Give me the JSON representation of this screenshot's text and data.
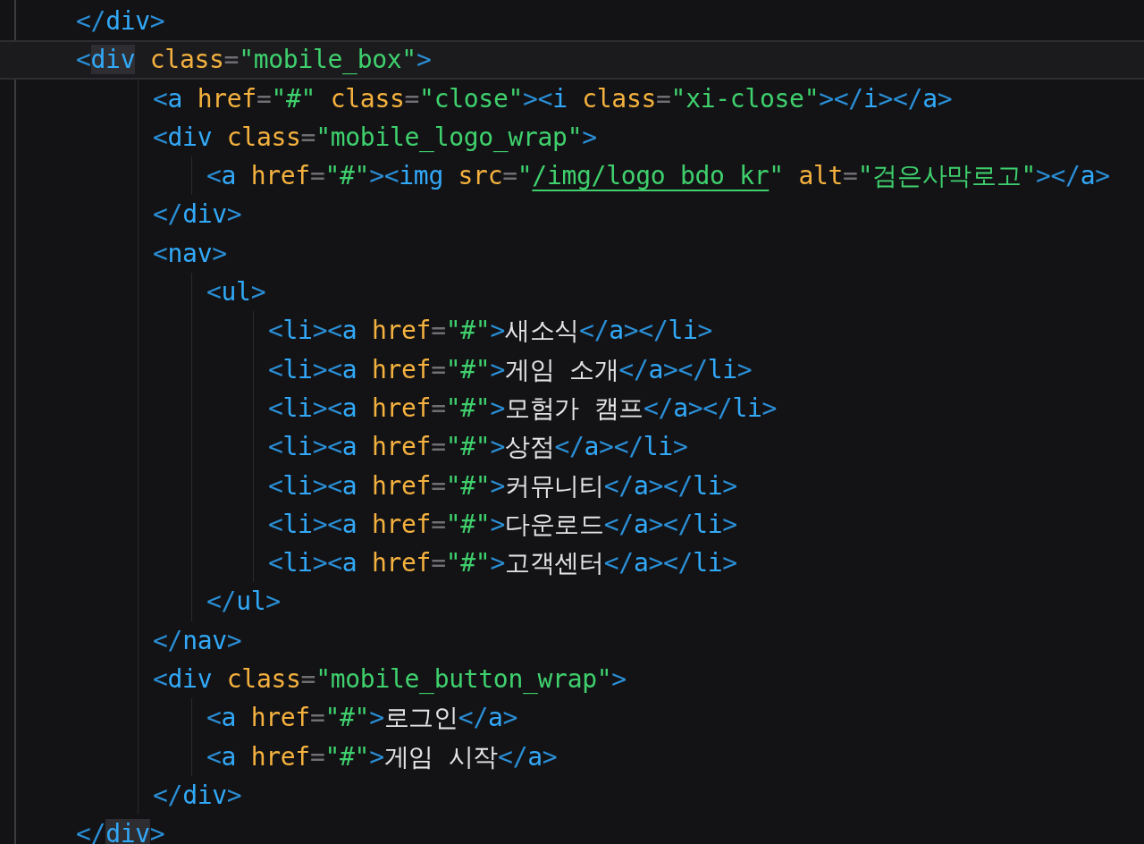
{
  "lines": [
    {
      "current": false,
      "tokens": [
        {
          "kind": "bracket",
          "text": "</"
        },
        {
          "kind": "tag",
          "text": "div"
        },
        {
          "kind": "bracket",
          "text": ">"
        }
      ]
    },
    {
      "current": true,
      "tokens": [
        {
          "kind": "bracket",
          "text": "<"
        },
        {
          "kind": "tag-matched",
          "text": "div"
        },
        {
          "kind": "attr",
          "text": " class"
        },
        {
          "kind": "eq",
          "text": "="
        },
        {
          "kind": "str",
          "text": "\"mobile_box\""
        },
        {
          "kind": "bracket",
          "text": ">"
        }
      ],
      "children": [
        {
          "current": false,
          "tokens": [
            {
              "kind": "bracket",
              "text": "<"
            },
            {
              "kind": "tag",
              "text": "a"
            },
            {
              "kind": "attr",
              "text": " href"
            },
            {
              "kind": "eq",
              "text": "="
            },
            {
              "kind": "str",
              "text": "\"#\""
            },
            {
              "kind": "attr",
              "text": " class"
            },
            {
              "kind": "eq",
              "text": "="
            },
            {
              "kind": "str",
              "text": "\"close\""
            },
            {
              "kind": "bracket",
              "text": "><"
            },
            {
              "kind": "tag",
              "text": "i"
            },
            {
              "kind": "attr",
              "text": " class"
            },
            {
              "kind": "eq",
              "text": "="
            },
            {
              "kind": "str",
              "text": "\"xi-close\""
            },
            {
              "kind": "bracket",
              "text": "></"
            },
            {
              "kind": "tag",
              "text": "i"
            },
            {
              "kind": "bracket",
              "text": "></"
            },
            {
              "kind": "tag",
              "text": "a"
            },
            {
              "kind": "bracket",
              "text": ">"
            }
          ]
        },
        {
          "current": false,
          "tokens": [
            {
              "kind": "bracket",
              "text": "<"
            },
            {
              "kind": "tag",
              "text": "div"
            },
            {
              "kind": "attr",
              "text": " class"
            },
            {
              "kind": "eq",
              "text": "="
            },
            {
              "kind": "str",
              "text": "\"mobile_logo_wrap\""
            },
            {
              "kind": "bracket",
              "text": ">"
            }
          ],
          "children": [
            {
              "current": false,
              "tokens": [
                {
                  "kind": "bracket",
                  "text": "<"
                },
                {
                  "kind": "tag",
                  "text": "a"
                },
                {
                  "kind": "attr",
                  "text": " href"
                },
                {
                  "kind": "eq",
                  "text": "="
                },
                {
                  "kind": "str",
                  "text": "\"#\""
                },
                {
                  "kind": "bracket",
                  "text": "><"
                },
                {
                  "kind": "tag",
                  "text": "img"
                },
                {
                  "kind": "attr",
                  "text": " src"
                },
                {
                  "kind": "eq",
                  "text": "="
                },
                {
                  "kind": "str",
                  "text": "\""
                },
                {
                  "kind": "link",
                  "text": "/img/logo_bdo_kr"
                },
                {
                  "kind": "str",
                  "text": "\""
                },
                {
                  "kind": "attr",
                  "text": " alt"
                },
                {
                  "kind": "eq",
                  "text": "="
                },
                {
                  "kind": "str",
                  "text": "\"검은사막로고\""
                },
                {
                  "kind": "bracket",
                  "text": "></"
                },
                {
                  "kind": "tag",
                  "text": "a"
                },
                {
                  "kind": "bracket",
                  "text": ">"
                }
              ]
            }
          ]
        },
        {
          "current": false,
          "tokens": [
            {
              "kind": "bracket",
              "text": "</"
            },
            {
              "kind": "tag",
              "text": "div"
            },
            {
              "kind": "bracket",
              "text": ">"
            }
          ]
        },
        {
          "current": false,
          "tokens": [
            {
              "kind": "bracket",
              "text": "<"
            },
            {
              "kind": "tag",
              "text": "nav"
            },
            {
              "kind": "bracket",
              "text": ">"
            }
          ],
          "children": [
            {
              "current": false,
              "tokens": [
                {
                  "kind": "bracket",
                  "text": "<"
                },
                {
                  "kind": "tag",
                  "text": "ul"
                },
                {
                  "kind": "bracket",
                  "text": ">"
                }
              ],
              "children": [
                {
                  "current": false,
                  "tokens": [
                    {
                      "kind": "bracket",
                      "text": "<"
                    },
                    {
                      "kind": "tag",
                      "text": "li"
                    },
                    {
                      "kind": "bracket",
                      "text": "><"
                    },
                    {
                      "kind": "tag",
                      "text": "a"
                    },
                    {
                      "kind": "attr",
                      "text": " href"
                    },
                    {
                      "kind": "eq",
                      "text": "="
                    },
                    {
                      "kind": "str",
                      "text": "\"#\""
                    },
                    {
                      "kind": "bracket",
                      "text": ">"
                    },
                    {
                      "kind": "text",
                      "text": "새소식"
                    },
                    {
                      "kind": "bracket",
                      "text": "</"
                    },
                    {
                      "kind": "tag",
                      "text": "a"
                    },
                    {
                      "kind": "bracket",
                      "text": "></"
                    },
                    {
                      "kind": "tag",
                      "text": "li"
                    },
                    {
                      "kind": "bracket",
                      "text": ">"
                    }
                  ]
                },
                {
                  "current": false,
                  "tokens": [
                    {
                      "kind": "bracket",
                      "text": "<"
                    },
                    {
                      "kind": "tag",
                      "text": "li"
                    },
                    {
                      "kind": "bracket",
                      "text": "><"
                    },
                    {
                      "kind": "tag",
                      "text": "a"
                    },
                    {
                      "kind": "attr",
                      "text": " href"
                    },
                    {
                      "kind": "eq",
                      "text": "="
                    },
                    {
                      "kind": "str",
                      "text": "\"#\""
                    },
                    {
                      "kind": "bracket",
                      "text": ">"
                    },
                    {
                      "kind": "text",
                      "text": "게임 소개"
                    },
                    {
                      "kind": "bracket",
                      "text": "</"
                    },
                    {
                      "kind": "tag",
                      "text": "a"
                    },
                    {
                      "kind": "bracket",
                      "text": "></"
                    },
                    {
                      "kind": "tag",
                      "text": "li"
                    },
                    {
                      "kind": "bracket",
                      "text": ">"
                    }
                  ]
                },
                {
                  "current": false,
                  "tokens": [
                    {
                      "kind": "bracket",
                      "text": "<"
                    },
                    {
                      "kind": "tag",
                      "text": "li"
                    },
                    {
                      "kind": "bracket",
                      "text": "><"
                    },
                    {
                      "kind": "tag",
                      "text": "a"
                    },
                    {
                      "kind": "attr",
                      "text": " href"
                    },
                    {
                      "kind": "eq",
                      "text": "="
                    },
                    {
                      "kind": "str",
                      "text": "\"#\""
                    },
                    {
                      "kind": "bracket",
                      "text": ">"
                    },
                    {
                      "kind": "text",
                      "text": "모험가 캠프"
                    },
                    {
                      "kind": "bracket",
                      "text": "</"
                    },
                    {
                      "kind": "tag",
                      "text": "a"
                    },
                    {
                      "kind": "bracket",
                      "text": "></"
                    },
                    {
                      "kind": "tag",
                      "text": "li"
                    },
                    {
                      "kind": "bracket",
                      "text": ">"
                    }
                  ]
                },
                {
                  "current": false,
                  "tokens": [
                    {
                      "kind": "bracket",
                      "text": "<"
                    },
                    {
                      "kind": "tag",
                      "text": "li"
                    },
                    {
                      "kind": "bracket",
                      "text": "><"
                    },
                    {
                      "kind": "tag",
                      "text": "a"
                    },
                    {
                      "kind": "attr",
                      "text": " href"
                    },
                    {
                      "kind": "eq",
                      "text": "="
                    },
                    {
                      "kind": "str",
                      "text": "\"#\""
                    },
                    {
                      "kind": "bracket",
                      "text": ">"
                    },
                    {
                      "kind": "text",
                      "text": "상점"
                    },
                    {
                      "kind": "bracket",
                      "text": "</"
                    },
                    {
                      "kind": "tag",
                      "text": "a"
                    },
                    {
                      "kind": "bracket",
                      "text": "></"
                    },
                    {
                      "kind": "tag",
                      "text": "li"
                    },
                    {
                      "kind": "bracket",
                      "text": ">"
                    }
                  ]
                },
                {
                  "current": false,
                  "tokens": [
                    {
                      "kind": "bracket",
                      "text": "<"
                    },
                    {
                      "kind": "tag",
                      "text": "li"
                    },
                    {
                      "kind": "bracket",
                      "text": "><"
                    },
                    {
                      "kind": "tag",
                      "text": "a"
                    },
                    {
                      "kind": "attr",
                      "text": " href"
                    },
                    {
                      "kind": "eq",
                      "text": "="
                    },
                    {
                      "kind": "str",
                      "text": "\"#\""
                    },
                    {
                      "kind": "bracket",
                      "text": ">"
                    },
                    {
                      "kind": "text",
                      "text": "커뮤니티"
                    },
                    {
                      "kind": "bracket",
                      "text": "</"
                    },
                    {
                      "kind": "tag",
                      "text": "a"
                    },
                    {
                      "kind": "bracket",
                      "text": "></"
                    },
                    {
                      "kind": "tag",
                      "text": "li"
                    },
                    {
                      "kind": "bracket",
                      "text": ">"
                    }
                  ]
                },
                {
                  "current": false,
                  "tokens": [
                    {
                      "kind": "bracket",
                      "text": "<"
                    },
                    {
                      "kind": "tag",
                      "text": "li"
                    },
                    {
                      "kind": "bracket",
                      "text": "><"
                    },
                    {
                      "kind": "tag",
                      "text": "a"
                    },
                    {
                      "kind": "attr",
                      "text": " href"
                    },
                    {
                      "kind": "eq",
                      "text": "="
                    },
                    {
                      "kind": "str",
                      "text": "\"#\""
                    },
                    {
                      "kind": "bracket",
                      "text": ">"
                    },
                    {
                      "kind": "text",
                      "text": "다운로드"
                    },
                    {
                      "kind": "bracket",
                      "text": "</"
                    },
                    {
                      "kind": "tag",
                      "text": "a"
                    },
                    {
                      "kind": "bracket",
                      "text": "></"
                    },
                    {
                      "kind": "tag",
                      "text": "li"
                    },
                    {
                      "kind": "bracket",
                      "text": ">"
                    }
                  ]
                },
                {
                  "current": false,
                  "tokens": [
                    {
                      "kind": "bracket",
                      "text": "<"
                    },
                    {
                      "kind": "tag",
                      "text": "li"
                    },
                    {
                      "kind": "bracket",
                      "text": "><"
                    },
                    {
                      "kind": "tag",
                      "text": "a"
                    },
                    {
                      "kind": "attr",
                      "text": " href"
                    },
                    {
                      "kind": "eq",
                      "text": "="
                    },
                    {
                      "kind": "str",
                      "text": "\"#\""
                    },
                    {
                      "kind": "bracket",
                      "text": ">"
                    },
                    {
                      "kind": "text",
                      "text": "고객센터"
                    },
                    {
                      "kind": "bracket",
                      "text": "</"
                    },
                    {
                      "kind": "tag",
                      "text": "a"
                    },
                    {
                      "kind": "bracket",
                      "text": "></"
                    },
                    {
                      "kind": "tag",
                      "text": "li"
                    },
                    {
                      "kind": "bracket",
                      "text": ">"
                    }
                  ]
                }
              ]
            },
            {
              "current": false,
              "tokens": [
                {
                  "kind": "bracket",
                  "text": "</"
                },
                {
                  "kind": "tag",
                  "text": "ul"
                },
                {
                  "kind": "bracket",
                  "text": ">"
                }
              ]
            }
          ]
        },
        {
          "current": false,
          "tokens": [
            {
              "kind": "bracket",
              "text": "</"
            },
            {
              "kind": "tag",
              "text": "nav"
            },
            {
              "kind": "bracket",
              "text": ">"
            }
          ]
        },
        {
          "current": false,
          "tokens": [
            {
              "kind": "bracket",
              "text": "<"
            },
            {
              "kind": "tag",
              "text": "div"
            },
            {
              "kind": "attr",
              "text": " class"
            },
            {
              "kind": "eq",
              "text": "="
            },
            {
              "kind": "str",
              "text": "\"mobile_button_wrap\""
            },
            {
              "kind": "bracket",
              "text": ">"
            }
          ],
          "children": [
            {
              "current": false,
              "tokens": [
                {
                  "kind": "bracket",
                  "text": "<"
                },
                {
                  "kind": "tag",
                  "text": "a"
                },
                {
                  "kind": "attr",
                  "text": " href"
                },
                {
                  "kind": "eq",
                  "text": "="
                },
                {
                  "kind": "str",
                  "text": "\"#\""
                },
                {
                  "kind": "bracket",
                  "text": ">"
                },
                {
                  "kind": "text",
                  "text": "로그인"
                },
                {
                  "kind": "bracket",
                  "text": "</"
                },
                {
                  "kind": "tag",
                  "text": "a"
                },
                {
                  "kind": "bracket",
                  "text": ">"
                }
              ]
            },
            {
              "current": false,
              "tokens": [
                {
                  "kind": "bracket",
                  "text": "<"
                },
                {
                  "kind": "tag",
                  "text": "a"
                },
                {
                  "kind": "attr",
                  "text": " href"
                },
                {
                  "kind": "eq",
                  "text": "="
                },
                {
                  "kind": "str",
                  "text": "\"#\""
                },
                {
                  "kind": "bracket",
                  "text": ">"
                },
                {
                  "kind": "text",
                  "text": "게임 시작"
                },
                {
                  "kind": "bracket",
                  "text": "</"
                },
                {
                  "kind": "tag",
                  "text": "a"
                },
                {
                  "kind": "bracket",
                  "text": ">"
                }
              ]
            }
          ]
        },
        {
          "current": false,
          "tokens": [
            {
              "kind": "bracket",
              "text": "</"
            },
            {
              "kind": "tag",
              "text": "div"
            },
            {
              "kind": "bracket",
              "text": ">"
            }
          ]
        }
      ]
    },
    {
      "current": false,
      "tokens": [
        {
          "kind": "bracket",
          "text": "</"
        },
        {
          "kind": "tag-matched",
          "text": "div"
        },
        {
          "kind": "bracket",
          "text": ">"
        }
      ]
    }
  ]
}
